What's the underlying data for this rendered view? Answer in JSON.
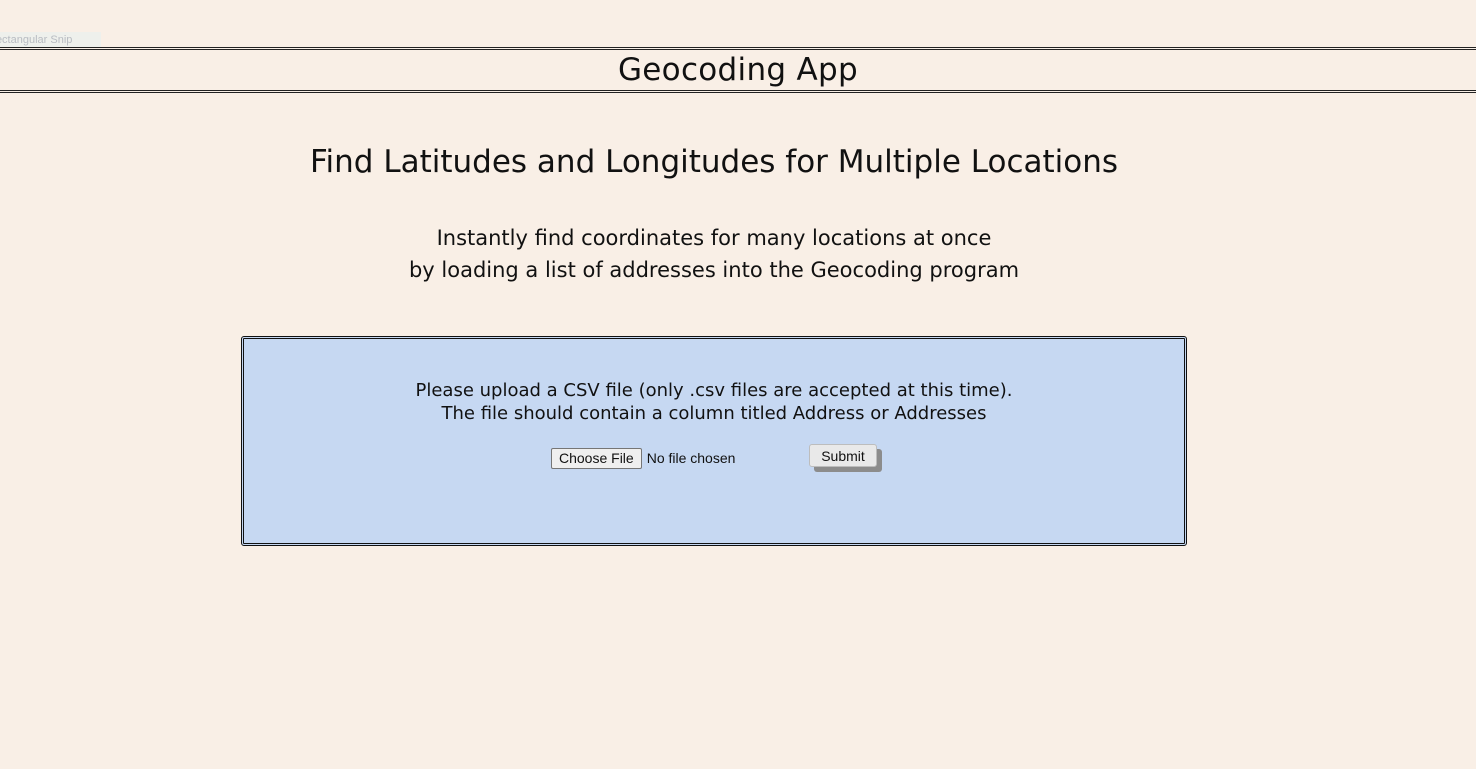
{
  "overlay": {
    "snip_label": "Rectangular Snip"
  },
  "header": {
    "app_title": "Geocoding App"
  },
  "main": {
    "headline": "Find Latitudes and Longitudes for Multiple Locations",
    "subtext_line1": "Instantly find coordinates for many locations at once",
    "subtext_line2": "by loading a list of addresses into the Geocoding program"
  },
  "upload": {
    "instruction_line1": "Please upload a CSV file (only .csv files are accepted at this time).",
    "instruction_line2": "The file should contain a column titled Address or Addresses",
    "choose_file_label": "Choose File",
    "file_status": "No file chosen",
    "submit_label": "Submit"
  },
  "colors": {
    "page_background": "#f9efe6",
    "upload_box_background": "#c6d8f2"
  }
}
